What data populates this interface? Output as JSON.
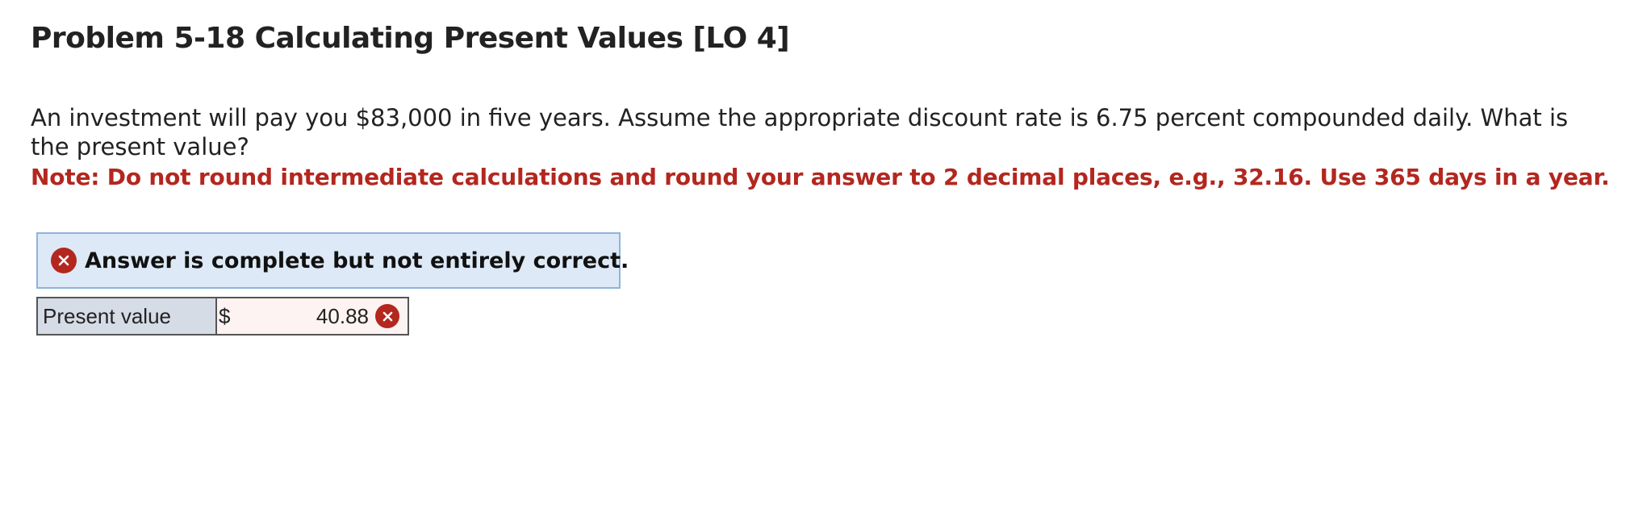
{
  "problem": {
    "title": "Problem 5-18 Calculating Present Values [LO 4]",
    "question": "An investment will pay you $83,000 in five years. Assume the appropriate discount rate is 6.75 percent compounded daily. What is the present value?",
    "note": "Note: Do not round intermediate calculations and round your answer to 2 decimal places, e.g., 32.16. Use 365 days in a year."
  },
  "feedback": {
    "status_text": "Answer is complete but not entirely correct.",
    "status_icon": "x-circle-icon"
  },
  "answer": {
    "label": "Present value",
    "currency": "$",
    "value": "40.88",
    "result_icon": "x-circle-icon"
  },
  "colors": {
    "note": "#b3271f",
    "status_background": "#dde9f6",
    "status_border": "#8fb4dd",
    "incorrect": "#b3271f",
    "label_cell": "#d6dce6",
    "answer_cell": "#fcf3f2"
  }
}
